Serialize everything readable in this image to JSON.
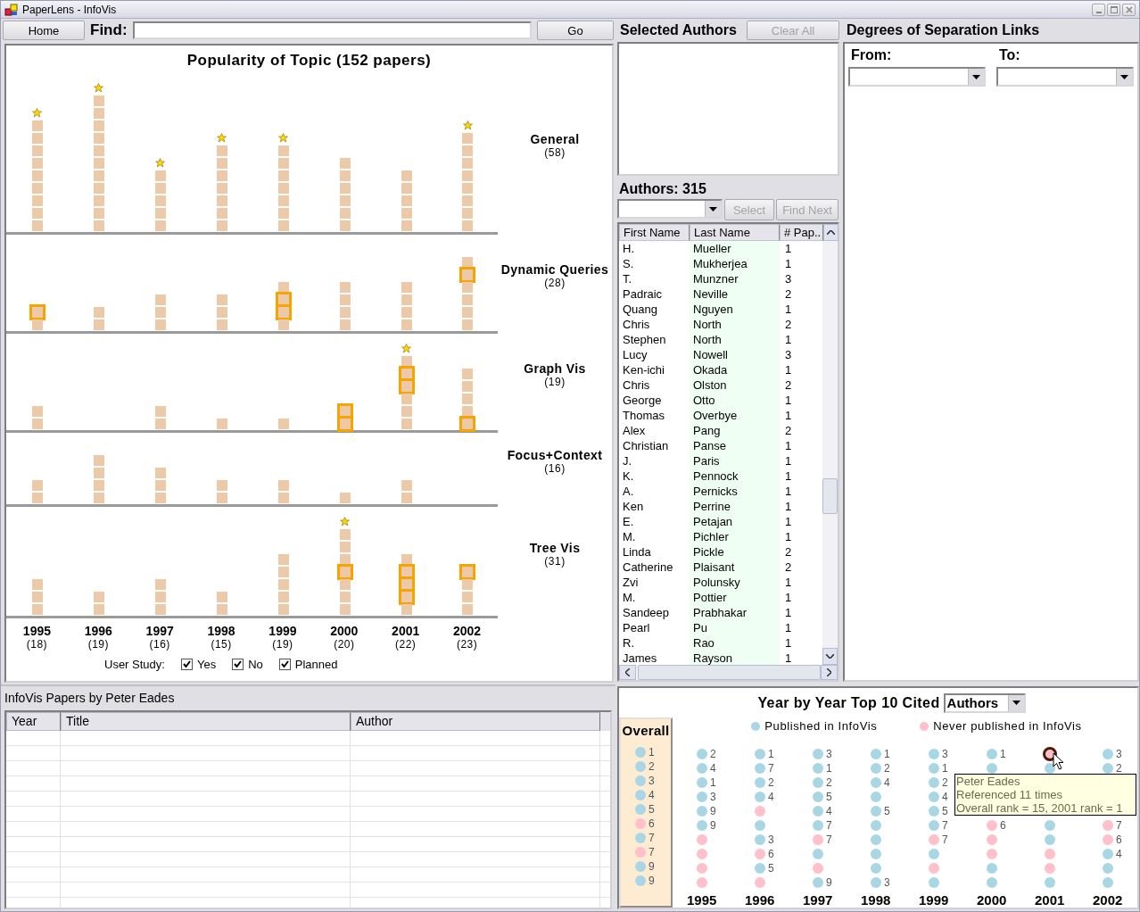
{
  "window": {
    "title": "PaperLens - InfoVis"
  },
  "toolbar": {
    "home_button": "Home",
    "find_label": "Find:",
    "go_button": "Go"
  },
  "topic_chart": {
    "title": "Popularity of Topic (152 papers)",
    "topics": [
      {
        "name": "General",
        "count": "(58)",
        "bars": [
          {
            "star": true,
            "cells": [
              {
                "highlighted": false
              },
              {
                "highlighted": false
              },
              {
                "highlighted": false
              },
              {
                "highlighted": false
              },
              {
                "highlighted": false
              },
              {
                "highlighted": false
              },
              {
                "highlighted": false
              },
              {
                "highlighted": false
              },
              {
                "highlighted": false
              }
            ]
          },
          {
            "star": true,
            "cells": [
              {
                "highlighted": false
              },
              {
                "highlighted": false
              },
              {
                "highlighted": false
              },
              {
                "highlighted": false
              },
              {
                "highlighted": false
              },
              {
                "highlighted": false
              },
              {
                "highlighted": false
              },
              {
                "highlighted": false
              },
              {
                "highlighted": false
              },
              {
                "highlighted": false
              },
              {
                "highlighted": false
              }
            ]
          },
          {
            "star": true,
            "cells": [
              {
                "highlighted": false
              },
              {
                "highlighted": false
              },
              {
                "highlighted": false
              },
              {
                "highlighted": false
              },
              {
                "highlighted": false
              }
            ]
          },
          {
            "star": true,
            "cells": [
              {
                "highlighted": false
              },
              {
                "highlighted": false
              },
              {
                "highlighted": false
              },
              {
                "highlighted": false
              },
              {
                "highlighted": false
              },
              {
                "highlighted": false
              },
              {
                "highlighted": false
              }
            ]
          },
          {
            "star": true,
            "cells": [
              {
                "highlighted": false
              },
              {
                "highlighted": false
              },
              {
                "highlighted": false
              },
              {
                "highlighted": false
              },
              {
                "highlighted": false
              },
              {
                "highlighted": false
              },
              {
                "highlighted": false
              }
            ]
          },
          {
            "cells": [
              {
                "highlighted": false
              },
              {
                "highlighted": false
              },
              {
                "highlighted": false
              },
              {
                "highlighted": false
              },
              {
                "highlighted": false
              },
              {
                "highlighted": false
              }
            ]
          },
          {
            "cells": [
              {
                "highlighted": false
              },
              {
                "highlighted": false
              },
              {
                "highlighted": false
              },
              {
                "highlighted": false
              },
              {
                "highlighted": false
              }
            ]
          },
          {
            "star": true,
            "cells": [
              {
                "highlighted": false
              },
              {
                "highlighted": false
              },
              {
                "highlighted": false
              },
              {
                "highlighted": false
              },
              {
                "highlighted": false
              },
              {
                "highlighted": false
              },
              {
                "highlighted": false
              },
              {
                "highlighted": false
              }
            ]
          }
        ]
      },
      {
        "name": "Dynamic Queries",
        "count": "(28)",
        "bars": [
          {
            "cells": [
              {
                "highlighted": false
              },
              {
                "highlighted": true
              }
            ]
          },
          {
            "cells": [
              {
                "highlighted": false
              },
              {
                "highlighted": false
              }
            ]
          },
          {
            "cells": [
              {
                "highlighted": false
              },
              {
                "highlighted": false
              },
              {
                "highlighted": false
              }
            ]
          },
          {
            "cells": [
              {
                "highlighted": false
              },
              {
                "highlighted": false
              },
              {
                "highlighted": false
              }
            ]
          },
          {
            "cells": [
              {
                "highlighted": false
              },
              {
                "highlighted": true
              },
              {
                "highlighted": true
              },
              {
                "highlighted": false
              }
            ]
          },
          {
            "cells": [
              {
                "highlighted": false
              },
              {
                "highlighted": false
              },
              {
                "highlighted": false
              },
              {
                "highlighted": false
              }
            ]
          },
          {
            "cells": [
              {
                "highlighted": false
              },
              {
                "highlighted": false
              },
              {
                "highlighted": false
              },
              {
                "highlighted": false
              }
            ]
          },
          {
            "cells": [
              {
                "highlighted": false
              },
              {
                "highlighted": false
              },
              {
                "highlighted": false
              },
              {
                "highlighted": false
              },
              {
                "highlighted": true
              },
              {
                "highlighted": false
              }
            ]
          }
        ]
      },
      {
        "name": "Graph Vis",
        "count": "(19)",
        "bars": [
          {
            "cells": [
              {
                "highlighted": false
              },
              {
                "highlighted": false
              }
            ]
          },
          {
            "star": false
          },
          {
            "cells": [
              {
                "highlighted": false
              },
              {
                "highlighted": false
              }
            ]
          },
          {
            "cells": [
              {
                "highlighted": false
              }
            ]
          },
          {
            "cells": [
              {
                "highlighted": false
              }
            ]
          },
          {
            "cells": [
              {
                "highlighted": true
              },
              {
                "highlighted": true
              }
            ]
          },
          {
            "star": true,
            "cells": [
              {
                "highlighted": false
              },
              {
                "highlighted": false
              },
              {
                "highlighted": false
              },
              {
                "highlighted": true
              },
              {
                "highlighted": true
              },
              {
                "highlighted": false
              }
            ]
          },
          {
            "cells": [
              {
                "highlighted": true
              },
              {
                "highlighted": false
              },
              {
                "highlighted": false
              },
              {
                "highlighted": false
              },
              {
                "highlighted": false
              }
            ]
          }
        ]
      },
      {
        "name": "Focus+Context",
        "count": "(16)",
        "bars": [
          {
            "cells": [
              {
                "highlighted": false
              },
              {
                "highlighted": false
              }
            ]
          },
          {
            "cells": [
              {
                "highlighted": false
              },
              {
                "highlighted": false
              },
              {
                "highlighted": false
              },
              {
                "highlighted": false
              }
            ]
          },
          {
            "cells": [
              {
                "highlighted": false
              },
              {
                "highlighted": false
              },
              {
                "highlighted": false
              }
            ]
          },
          {
            "cells": [
              {
                "highlighted": false
              },
              {
                "highlighted": false
              }
            ]
          },
          {
            "cells": [
              {
                "highlighted": false
              },
              {
                "highlighted": false
              }
            ]
          },
          {
            "cells": [
              {
                "highlighted": false
              }
            ]
          },
          {
            "cells": [
              {
                "highlighted": false
              },
              {
                "highlighted": false
              }
            ]
          },
          {
            "star": false
          }
        ]
      },
      {
        "name": "Tree Vis",
        "count": "(31)",
        "bars": [
          {
            "cells": [
              {
                "highlighted": false
              },
              {
                "highlighted": false
              },
              {
                "highlighted": false
              }
            ]
          },
          {
            "cells": [
              {
                "highlighted": false
              },
              {
                "highlighted": false
              }
            ]
          },
          {
            "cells": [
              {
                "highlighted": false
              },
              {
                "highlighted": false
              },
              {
                "highlighted": false
              }
            ]
          },
          {
            "cells": [
              {
                "highlighted": false
              },
              {
                "highlighted": false
              }
            ]
          },
          {
            "cells": [
              {
                "highlighted": false
              },
              {
                "highlighted": false
              },
              {
                "highlighted": false
              },
              {
                "highlighted": false
              },
              {
                "highlighted": false
              }
            ]
          },
          {
            "star": true,
            "cells": [
              {
                "highlighted": false
              },
              {
                "highlighted": false
              },
              {
                "highlighted": false
              },
              {
                "highlighted": true
              },
              {
                "highlighted": false
              },
              {
                "highlighted": false
              },
              {
                "highlighted": false
              }
            ]
          },
          {
            "cells": [
              {
                "highlighted": false
              },
              {
                "highlighted": true
              },
              {
                "highlighted": true
              },
              {
                "highlighted": true
              },
              {
                "highlighted": false
              }
            ]
          },
          {
            "cells": [
              {
                "highlighted": false
              },
              {
                "highlighted": false
              },
              {
                "highlighted": false
              },
              {
                "highlighted": true
              }
            ]
          }
        ]
      }
    ],
    "years": [
      {
        "year": "1995",
        "count": "(18)"
      },
      {
        "year": "1996",
        "count": "(19)"
      },
      {
        "year": "1997",
        "count": "(16)"
      },
      {
        "year": "1998",
        "count": "(15)"
      },
      {
        "year": "1999",
        "count": "(19)"
      },
      {
        "year": "2000",
        "count": "(20)"
      },
      {
        "year": "2001",
        "count": "(22)"
      },
      {
        "year": "2002",
        "count": "(23)"
      }
    ],
    "user_study": {
      "label": "User Study:",
      "options": [
        {
          "label": "Yes",
          "checked": true
        },
        {
          "label": "No",
          "checked": true
        },
        {
          "label": "Planned",
          "checked": true
        }
      ]
    }
  },
  "selected_authors": {
    "title": "Selected Authors",
    "clear_button": {
      "label": "Clear All",
      "disabled": true
    }
  },
  "authors": {
    "title": "Authors: 315",
    "select_button": {
      "label": "Select",
      "disabled": true
    },
    "find_next_button": {
      "label": "Find Next",
      "disabled": true
    },
    "columns": [
      "First Name",
      "Last Name",
      "# Pap.."
    ],
    "rows": [
      [
        "H.",
        "Mueller",
        "1"
      ],
      [
        "S.",
        "Mukherjea",
        "1"
      ],
      [
        "T.",
        "Munzner",
        "3"
      ],
      [
        "Padraic",
        "Neville",
        "2"
      ],
      [
        "Quang",
        "Nguyen",
        "1"
      ],
      [
        "Chris",
        "North",
        "2"
      ],
      [
        "Stephen",
        "North",
        "1"
      ],
      [
        "Lucy",
        "Nowell",
        "3"
      ],
      [
        "Ken-ichi",
        "Okada",
        "1"
      ],
      [
        "Chris",
        "Olston",
        "2"
      ],
      [
        "George",
        "Otto",
        "1"
      ],
      [
        "Thomas",
        "Overbye",
        "1"
      ],
      [
        "Alex",
        "Pang",
        "2"
      ],
      [
        "Christian",
        "Panse",
        "1"
      ],
      [
        "J.",
        "Paris",
        "1"
      ],
      [
        "K.",
        "Pennock",
        "1"
      ],
      [
        "A.",
        "Pernicks",
        "1"
      ],
      [
        "Ken",
        "Perrine",
        "1"
      ],
      [
        "E.",
        "Petajan",
        "1"
      ],
      [
        "M.",
        "Pichler",
        "1"
      ],
      [
        "Linda",
        "Pickle",
        "2"
      ],
      [
        "Catherine",
        "Plaisant",
        "2"
      ],
      [
        "Zvi",
        "Polunsky",
        "1"
      ],
      [
        "M.",
        "Pottier",
        "1"
      ],
      [
        "Sandeep",
        "Prabhakar",
        "1"
      ],
      [
        "Pearl",
        "Pu",
        "1"
      ],
      [
        "R.",
        "Rao",
        "1"
      ],
      [
        "James",
        "Rayson",
        "1"
      ]
    ]
  },
  "separation": {
    "title": "Degrees of Separation Links",
    "from_label": "From:",
    "to_label": "To:"
  },
  "papers": {
    "title": "InfoVis Papers by Peter Eades",
    "columns": [
      "Year",
      "Title",
      "Author"
    ]
  },
  "cited": {
    "title": "Year by Year Top 10 Cited",
    "mode": "Authors",
    "legend": [
      {
        "label": "Published in InfoVis",
        "color": "#a9d6e5"
      },
      {
        "label": "Never published in InfoVis",
        "color": "#ffbfcb"
      }
    ],
    "overall": {
      "title": "Overall",
      "dots": [
        {
          "color": "#a9d6e5",
          "label": "1"
        },
        {
          "color": "#a9d6e5",
          "label": "2"
        },
        {
          "color": "#a9d6e5",
          "label": "3"
        },
        {
          "color": "#a9d6e5",
          "label": "4"
        },
        {
          "color": "#a9d6e5",
          "label": "5"
        },
        {
          "color": "#ffbfcb",
          "label": "6"
        },
        {
          "color": "#a9d6e5",
          "label": "7"
        },
        {
          "color": "#ffbfcb",
          "label": "7"
        },
        {
          "color": "#a9d6e5",
          "label": "9"
        },
        {
          "color": "#a9d6e5",
          "label": "9"
        }
      ]
    },
    "years": [
      {
        "year": "1995",
        "dots": [
          {
            "color": "#a9d6e5",
            "label": "2",
            "hovered": false
          },
          {
            "color": "#a9d6e5",
            "label": "4",
            "hovered": false
          },
          {
            "color": "#a9d6e5",
            "label": "1",
            "hovered": false
          },
          {
            "color": "#a9d6e5",
            "label": "3",
            "hovered": false
          },
          {
            "color": "#a9d6e5",
            "label": "9",
            "hovered": false
          },
          {
            "color": "#a9d6e5",
            "label": "9",
            "hovered": false
          },
          {
            "color": "#ffbfcb",
            "hovered": false
          },
          {
            "color": "#ffbfcb",
            "hovered": false
          },
          {
            "color": "#ffbfcb",
            "hovered": false
          },
          {
            "color": "#ffbfcb",
            "hovered": false
          }
        ]
      },
      {
        "year": "1996",
        "dots": [
          {
            "color": "#a9d6e5",
            "label": "1",
            "hovered": false
          },
          {
            "color": "#a9d6e5",
            "label": "7",
            "hovered": false
          },
          {
            "color": "#a9d6e5",
            "label": "2",
            "hovered": false
          },
          {
            "color": "#a9d6e5",
            "label": "4",
            "hovered": false
          },
          {
            "color": "#ffbfcb",
            "hovered": false
          },
          {
            "color": "#a9d6e5",
            "hovered": false
          },
          {
            "color": "#a9d6e5",
            "label": "3",
            "hovered": false
          },
          {
            "color": "#ffbfcb",
            "label": "6",
            "hovered": false
          },
          {
            "color": "#a9d6e5",
            "label": "5",
            "hovered": false
          },
          {
            "color": "#ffbfcb",
            "hovered": false
          }
        ]
      },
      {
        "year": "1997",
        "dots": [
          {
            "color": "#a9d6e5",
            "label": "3",
            "hovered": false
          },
          {
            "color": "#a9d6e5",
            "label": "1",
            "hovered": false
          },
          {
            "color": "#a9d6e5",
            "label": "2",
            "hovered": false
          },
          {
            "color": "#a9d6e5",
            "label": "5",
            "hovered": false
          },
          {
            "color": "#a9d6e5",
            "label": "4",
            "hovered": false
          },
          {
            "color": "#a9d6e5",
            "label": "7",
            "hovered": false
          },
          {
            "color": "#ffbfcb",
            "label": "7",
            "hovered": false
          },
          {
            "color": "#a9d6e5",
            "hovered": false
          },
          {
            "color": "#ffbfcb",
            "hovered": false
          },
          {
            "color": "#a9d6e5",
            "label": "9",
            "hovered": false
          }
        ]
      },
      {
        "year": "1998",
        "dots": [
          {
            "color": "#a9d6e5",
            "label": "1",
            "hovered": false
          },
          {
            "color": "#a9d6e5",
            "label": "2",
            "hovered": false
          },
          {
            "color": "#a9d6e5",
            "label": "4",
            "hovered": false
          },
          {
            "color": "#a9d6e5",
            "hovered": false
          },
          {
            "color": "#a9d6e5",
            "label": "5",
            "hovered": false
          },
          {
            "color": "#a9d6e5",
            "hovered": false
          },
          {
            "color": "#a9d6e5",
            "hovered": false
          },
          {
            "color": "#a9d6e5",
            "hovered": false
          },
          {
            "color": "#a9d6e5",
            "hovered": false
          },
          {
            "color": "#a9d6e5",
            "label": "3",
            "hovered": false
          }
        ]
      },
      {
        "year": "1999",
        "dots": [
          {
            "color": "#a9d6e5",
            "label": "3",
            "hovered": false
          },
          {
            "color": "#a9d6e5",
            "label": "1",
            "hovered": false
          },
          {
            "color": "#a9d6e5",
            "label": "2",
            "hovered": false
          },
          {
            "color": "#a9d6e5",
            "label": "4",
            "hovered": false
          },
          {
            "color": "#a9d6e5",
            "label": "5",
            "hovered": false
          },
          {
            "color": "#a9d6e5",
            "label": "7",
            "hovered": false
          },
          {
            "color": "#ffbfcb",
            "label": "7",
            "hovered": false
          },
          {
            "color": "#a9d6e5",
            "hovered": false
          },
          {
            "color": "#ffbfcb",
            "hovered": false
          },
          {
            "color": "#a9d6e5",
            "hovered": false
          }
        ]
      },
      {
        "year": "2000",
        "dots": [
          {
            "color": "#a9d6e5",
            "label": "1",
            "hovered": false
          },
          {
            "color": "#a9d6e5",
            "hovered": false
          }
        ],
        "dots_below": [
          {
            "color": "#ffbfcb",
            "label": "6",
            "hovered": false
          },
          {
            "color": "#ffbfcb",
            "hovered": false
          },
          {
            "color": "#ffbfcb",
            "hovered": false
          },
          {
            "color": "#a9d6e5",
            "hovered": false
          },
          {
            "color": "#a9d6e5",
            "hovered": false
          }
        ]
      },
      {
        "year": "2001",
        "dots": [
          {
            "color": "#ffbfcb",
            "hovered": true
          },
          {
            "color": "#a9d6e5",
            "hovered": false
          }
        ],
        "dots_below": [
          {
            "color": "#a9d6e5",
            "hovered": false
          },
          {
            "color": "#a9d6e5",
            "hovered": false
          },
          {
            "color": "#ffbfcb",
            "hovered": false
          },
          {
            "color": "#ffbfcb",
            "hovered": false
          },
          {
            "color": "#a9d6e5",
            "hovered": false
          }
        ]
      },
      {
        "year": "2002",
        "dots": [
          {
            "color": "#a9d6e5",
            "label": "3",
            "hovered": false
          },
          {
            "color": "#a9d6e5",
            "label": "2",
            "hovered": false
          }
        ],
        "dots_below": [
          {
            "color": "#ffbfcb",
            "label": "7",
            "hovered": false
          },
          {
            "color": "#ffbfcb",
            "label": "6",
            "hovered": false
          },
          {
            "color": "#a9d6e5",
            "label": "4",
            "hovered": false
          },
          {
            "color": "#a9d6e5",
            "hovered": false
          },
          {
            "color": "#a9d6e5",
            "hovered": false
          }
        ]
      }
    ],
    "tooltip": {
      "lines": [
        "Peter Eades",
        "Referenced 11 times",
        "Overall rank = 15, 2001 rank = 1"
      ]
    }
  }
}
